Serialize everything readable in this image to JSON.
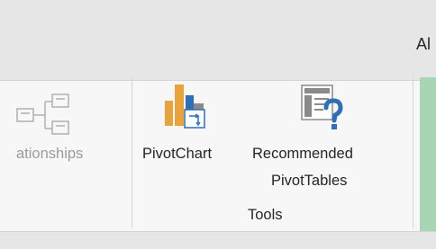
{
  "tabs": {
    "partial_tab_label": "Al"
  },
  "ribbon": {
    "relationships_label": "ationships",
    "pivotchart_label": "PivotChart",
    "recommended_label_line1": "Recommended",
    "recommended_label_line2": "PivotTables",
    "group_label": "Tools"
  },
  "colors": {
    "tabbar_bg": "#e6e6e6",
    "ribbon_bg": "#f7f7f7",
    "disabled_text": "#9b9b9b",
    "green_group": "#a8d5b3",
    "chart_orange": "#e8a33d",
    "chart_blue": "#2e6fb7"
  }
}
